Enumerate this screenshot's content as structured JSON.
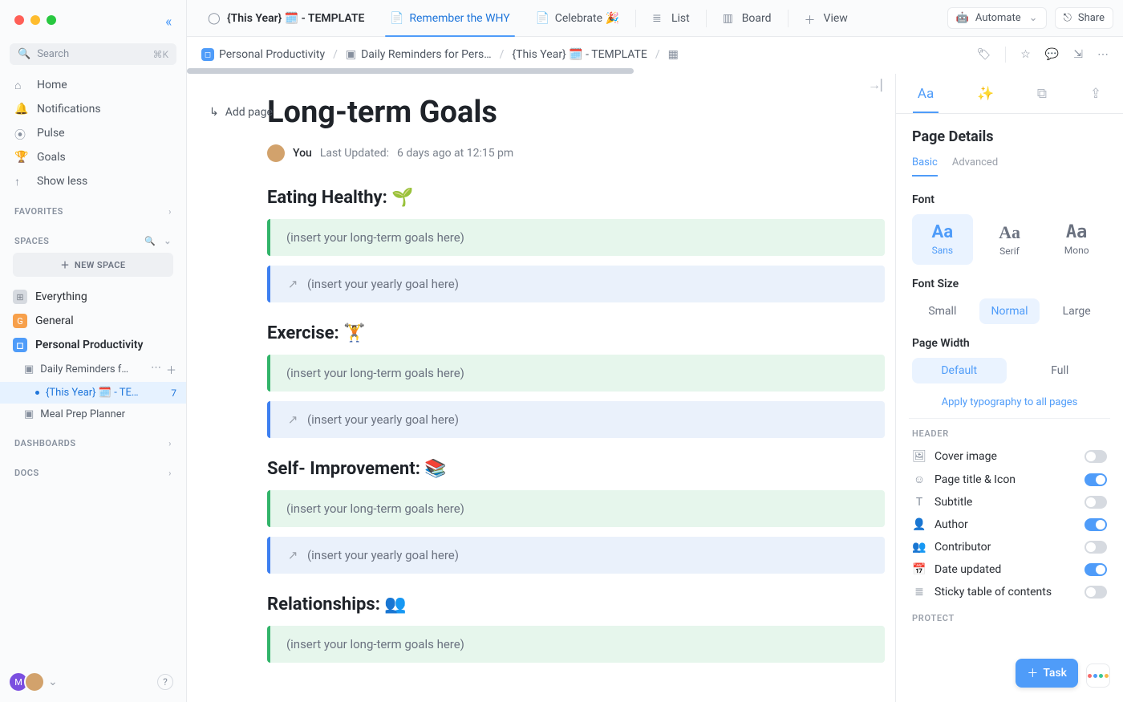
{
  "window": {
    "search_placeholder": "Search",
    "search_shortcut": "⌘K"
  },
  "nav": {
    "home": "Home",
    "notifications": "Notifications",
    "pulse": "Pulse",
    "goals": "Goals",
    "show_less": "Show less"
  },
  "sections": {
    "favorites": "FAVORITES",
    "spaces": "SPACES",
    "new_space": "NEW SPACE",
    "dashboards": "DASHBOARDS",
    "docs": "DOCS"
  },
  "spaces": {
    "everything": "Everything",
    "general": "General",
    "personal": "Personal Productivity",
    "daily_reminders": "Daily Reminders f…",
    "this_year": "{This Year} 🗓️ - TE…",
    "this_year_count": "7",
    "meal_prep": "Meal Prep Planner"
  },
  "tabs": {
    "current": "{This Year} 🗓️ - TEMPLATE",
    "remember": "Remember the WHY",
    "celebrate": "Celebrate 🎉",
    "list": "List",
    "board": "Board",
    "view": "View",
    "automate": "Automate",
    "share": "Share"
  },
  "breadcrumbs": {
    "space": "Personal Productivity",
    "folder": "Daily Reminders for Pers…",
    "page": "{This Year} 🗓️ - TEMPLATE"
  },
  "doc": {
    "add_page": "Add page",
    "title": "Long-term Goals",
    "author": "You",
    "updated_label": "Last Updated:",
    "updated_value": "6 days ago at 12:15 pm",
    "sections": [
      {
        "heading": "Eating Healthy: 🌱",
        "long": "(insert your long-term goals here)",
        "year": "(insert your yearly goal here)"
      },
      {
        "heading": "Exercise: 🏋️",
        "long": "(insert your long-term goals here)",
        "year": "(insert your yearly goal here)"
      },
      {
        "heading": "Self- Improvement: 📚",
        "long": "(insert your long-term goals here)",
        "year": "(insert your yearly goal here)"
      },
      {
        "heading": "Relationships: 👥",
        "long": "(insert your long-term goals here)",
        "year": ""
      }
    ]
  },
  "panel": {
    "title": "Page Details",
    "sub_basic": "Basic",
    "sub_advanced": "Advanced",
    "font_label": "Font",
    "font_sans": "Sans",
    "font_serif": "Serif",
    "font_mono": "Mono",
    "fontsize_label": "Font Size",
    "size_small": "Small",
    "size_normal": "Normal",
    "size_large": "Large",
    "width_label": "Page Width",
    "width_default": "Default",
    "width_full": "Full",
    "apply_all": "Apply typography to all pages",
    "header_label": "HEADER",
    "protect_label": "PROTECT",
    "toggles": {
      "cover": "Cover image",
      "title_icon": "Page title & Icon",
      "subtitle": "Subtitle",
      "author": "Author",
      "contributor": "Contributor",
      "date_updated": "Date updated",
      "sticky_toc": "Sticky table of contents"
    },
    "states": {
      "cover": false,
      "title_icon": true,
      "subtitle": false,
      "author": true,
      "contributor": false,
      "date_updated": true,
      "sticky_toc": false
    }
  },
  "fab": {
    "task": "Task"
  }
}
